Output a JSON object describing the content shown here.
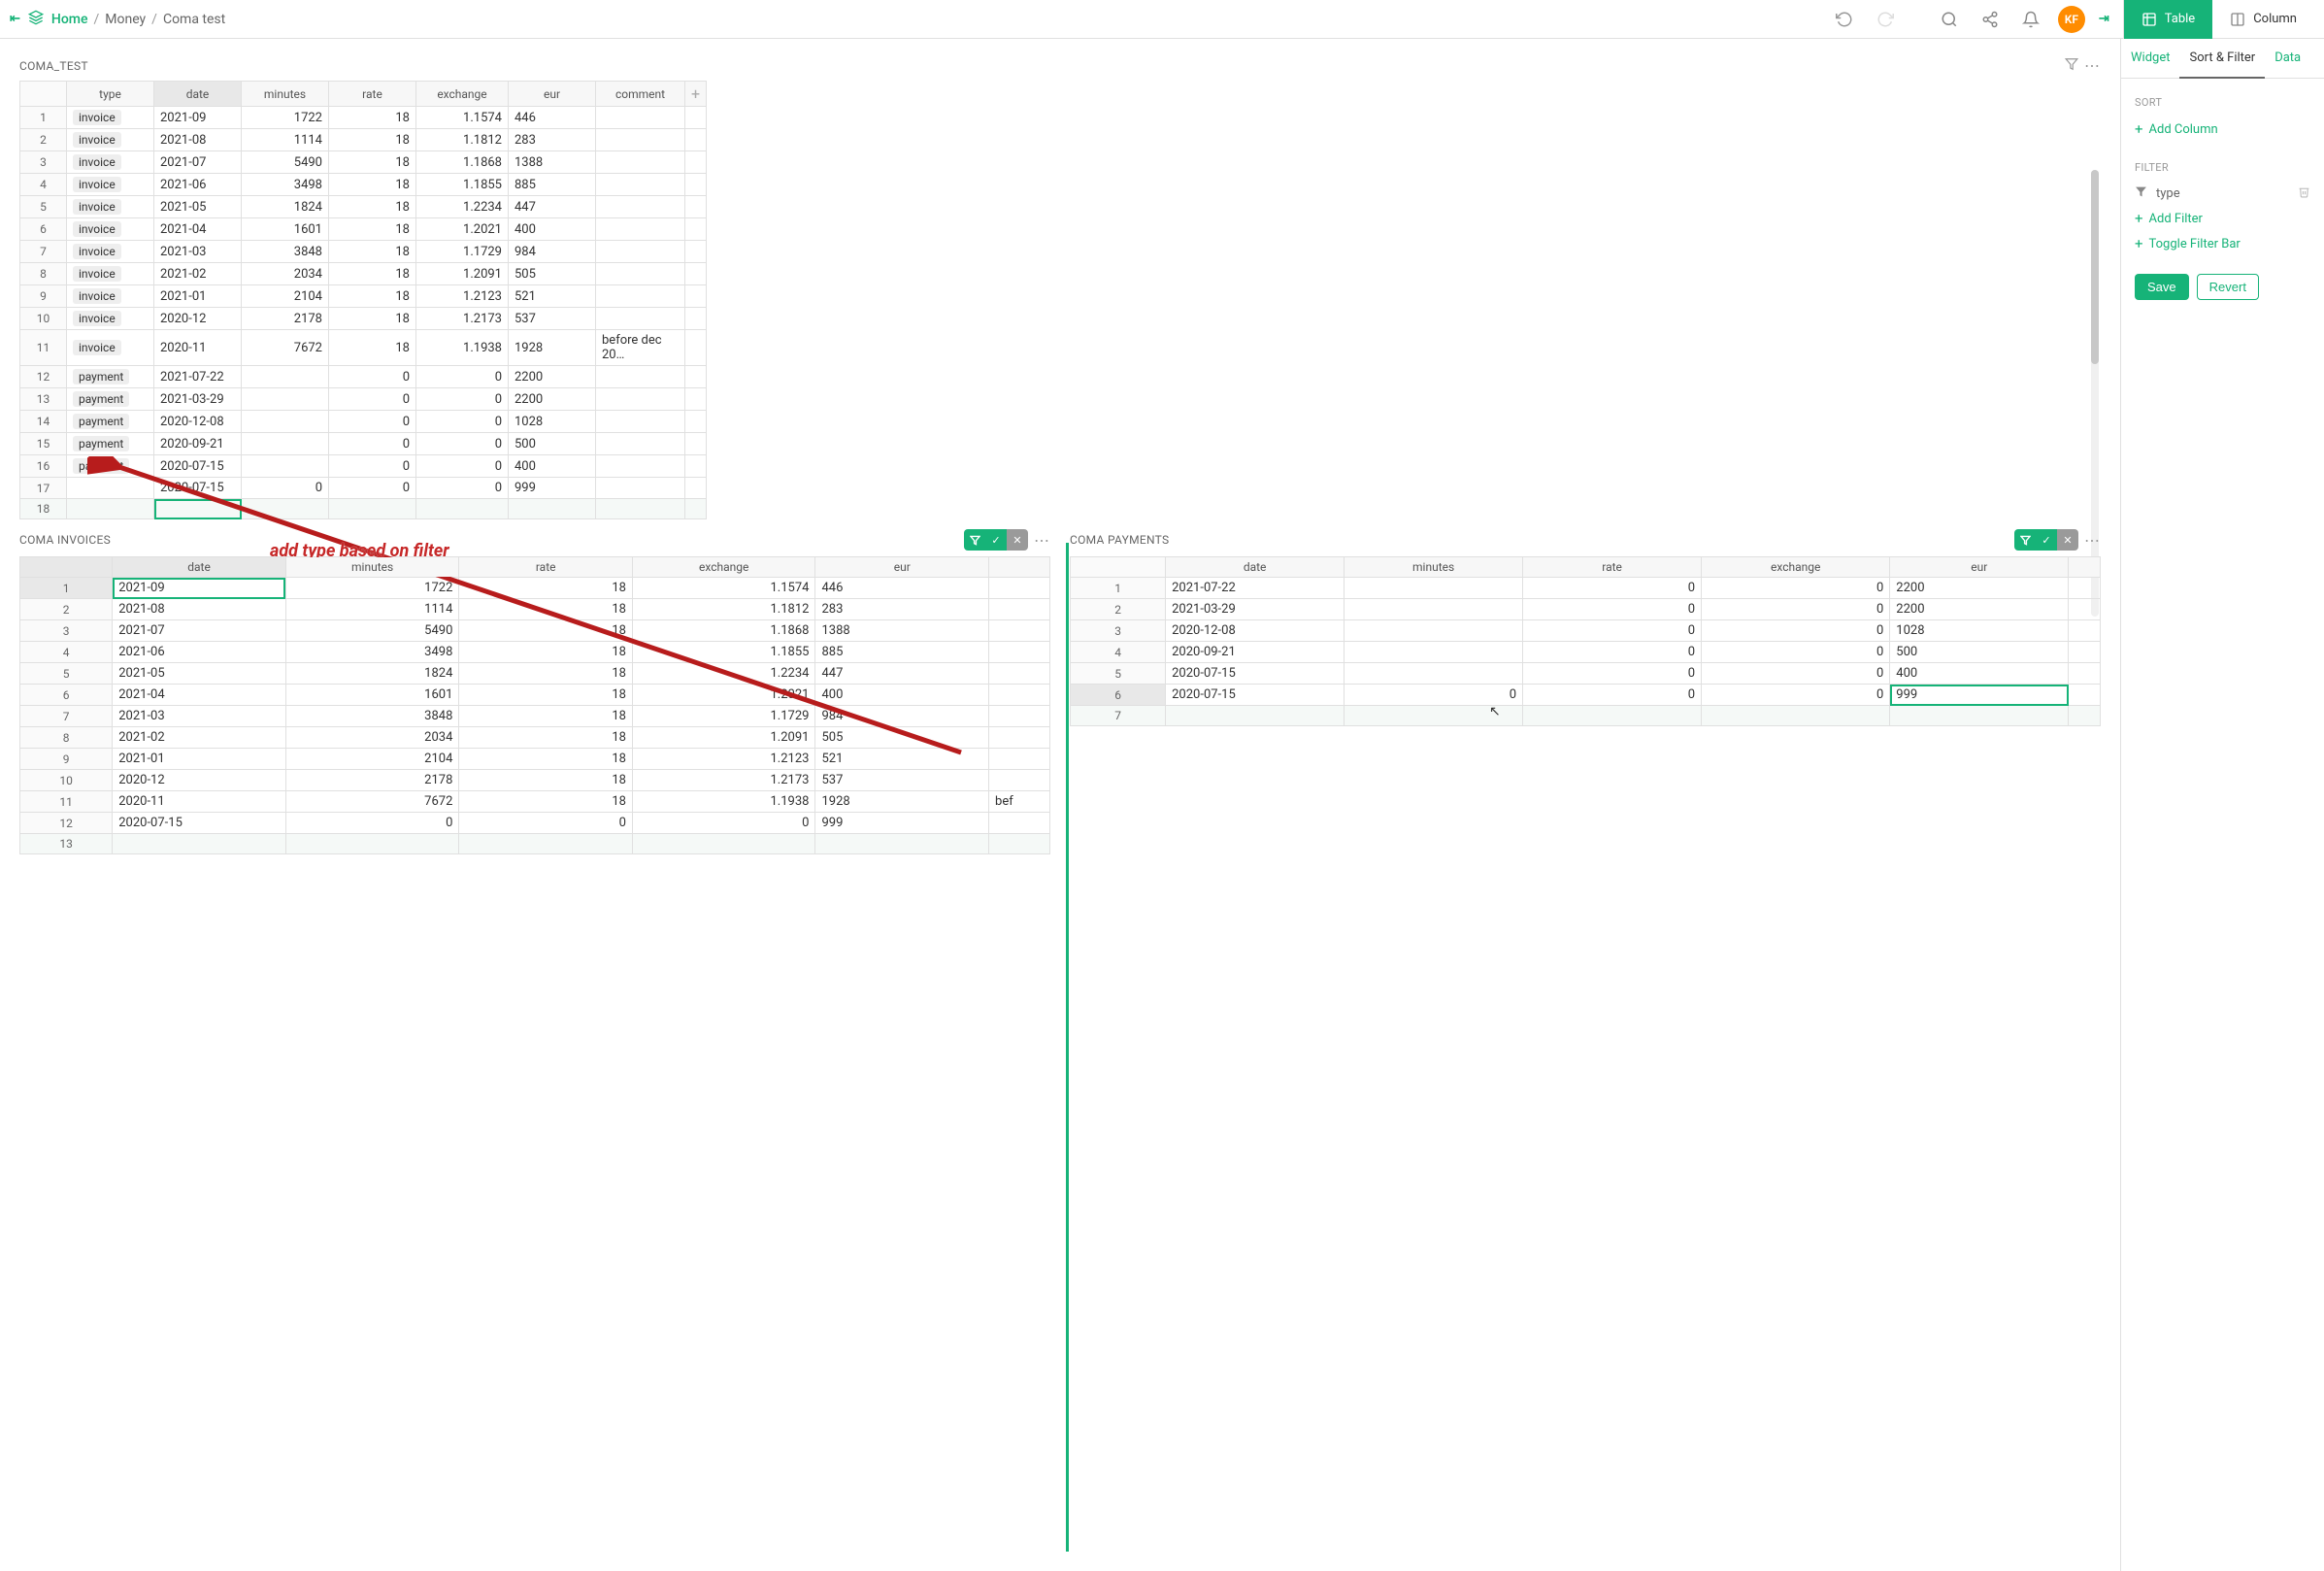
{
  "breadcrumb": {
    "home": "Home",
    "money": "Money",
    "doc": "Coma test"
  },
  "avatar": "KF",
  "view_tabs": {
    "table": "Table",
    "column": "Column"
  },
  "section1": {
    "title": "COMA_TEST",
    "cols": [
      "type",
      "date",
      "minutes",
      "rate",
      "exchange",
      "eur",
      "comment"
    ],
    "rows": [
      {
        "n": "1",
        "type": "invoice",
        "date": "2021-09",
        "min": "1722",
        "rate": "18",
        "exch": "1.1574",
        "eur": "446",
        "comm": ""
      },
      {
        "n": "2",
        "type": "invoice",
        "date": "2021-08",
        "min": "1114",
        "rate": "18",
        "exch": "1.1812",
        "eur": "283",
        "comm": ""
      },
      {
        "n": "3",
        "type": "invoice",
        "date": "2021-07",
        "min": "5490",
        "rate": "18",
        "exch": "1.1868",
        "eur": "1388",
        "comm": ""
      },
      {
        "n": "4",
        "type": "invoice",
        "date": "2021-06",
        "min": "3498",
        "rate": "18",
        "exch": "1.1855",
        "eur": "885",
        "comm": ""
      },
      {
        "n": "5",
        "type": "invoice",
        "date": "2021-05",
        "min": "1824",
        "rate": "18",
        "exch": "1.2234",
        "eur": "447",
        "comm": ""
      },
      {
        "n": "6",
        "type": "invoice",
        "date": "2021-04",
        "min": "1601",
        "rate": "18",
        "exch": "1.2021",
        "eur": "400",
        "comm": ""
      },
      {
        "n": "7",
        "type": "invoice",
        "date": "2021-03",
        "min": "3848",
        "rate": "18",
        "exch": "1.1729",
        "eur": "984",
        "comm": ""
      },
      {
        "n": "8",
        "type": "invoice",
        "date": "2021-02",
        "min": "2034",
        "rate": "18",
        "exch": "1.2091",
        "eur": "505",
        "comm": ""
      },
      {
        "n": "9",
        "type": "invoice",
        "date": "2021-01",
        "min": "2104",
        "rate": "18",
        "exch": "1.2123",
        "eur": "521",
        "comm": ""
      },
      {
        "n": "10",
        "type": "invoice",
        "date": "2020-12",
        "min": "2178",
        "rate": "18",
        "exch": "1.2173",
        "eur": "537",
        "comm": ""
      },
      {
        "n": "11",
        "type": "invoice",
        "date": "2020-11",
        "min": "7672",
        "rate": "18",
        "exch": "1.1938",
        "eur": "1928",
        "comm": "before dec 20…"
      },
      {
        "n": "12",
        "type": "payment",
        "date": "2021-07-22",
        "min": "",
        "rate": "0",
        "exch": "0",
        "eur": "2200",
        "comm": ""
      },
      {
        "n": "13",
        "type": "payment",
        "date": "2021-03-29",
        "min": "",
        "rate": "0",
        "exch": "0",
        "eur": "2200",
        "comm": ""
      },
      {
        "n": "14",
        "type": "payment",
        "date": "2020-12-08",
        "min": "",
        "rate": "0",
        "exch": "0",
        "eur": "1028",
        "comm": ""
      },
      {
        "n": "15",
        "type": "payment",
        "date": "2020-09-21",
        "min": "",
        "rate": "0",
        "exch": "0",
        "eur": "500",
        "comm": ""
      },
      {
        "n": "16",
        "type": "payment",
        "date": "2020-07-15",
        "min": "",
        "rate": "0",
        "exch": "0",
        "eur": "400",
        "comm": ""
      },
      {
        "n": "17",
        "type": "",
        "date": "2020-07-15",
        "min": "0",
        "rate": "0",
        "exch": "0",
        "eur": "999",
        "comm": ""
      }
    ],
    "newrow_n": "18"
  },
  "section2": {
    "title": "COMA INVOICES",
    "cols": [
      "date",
      "minutes",
      "rate",
      "exchange",
      "eur",
      ""
    ],
    "rows": [
      {
        "n": "1",
        "date": "2021-09",
        "min": "1722",
        "rate": "18",
        "exch": "1.1574",
        "eur": "446",
        "c": ""
      },
      {
        "n": "2",
        "date": "2021-08",
        "min": "1114",
        "rate": "18",
        "exch": "1.1812",
        "eur": "283",
        "c": ""
      },
      {
        "n": "3",
        "date": "2021-07",
        "min": "5490",
        "rate": "18",
        "exch": "1.1868",
        "eur": "1388",
        "c": ""
      },
      {
        "n": "4",
        "date": "2021-06",
        "min": "3498",
        "rate": "18",
        "exch": "1.1855",
        "eur": "885",
        "c": ""
      },
      {
        "n": "5",
        "date": "2021-05",
        "min": "1824",
        "rate": "18",
        "exch": "1.2234",
        "eur": "447",
        "c": ""
      },
      {
        "n": "6",
        "date": "2021-04",
        "min": "1601",
        "rate": "18",
        "exch": "1.2021",
        "eur": "400",
        "c": ""
      },
      {
        "n": "7",
        "date": "2021-03",
        "min": "3848",
        "rate": "18",
        "exch": "1.1729",
        "eur": "984",
        "c": ""
      },
      {
        "n": "8",
        "date": "2021-02",
        "min": "2034",
        "rate": "18",
        "exch": "1.2091",
        "eur": "505",
        "c": ""
      },
      {
        "n": "9",
        "date": "2021-01",
        "min": "2104",
        "rate": "18",
        "exch": "1.2123",
        "eur": "521",
        "c": ""
      },
      {
        "n": "10",
        "date": "2020-12",
        "min": "2178",
        "rate": "18",
        "exch": "1.2173",
        "eur": "537",
        "c": ""
      },
      {
        "n": "11",
        "date": "2020-11",
        "min": "7672",
        "rate": "18",
        "exch": "1.1938",
        "eur": "1928",
        "c": "bef"
      },
      {
        "n": "12",
        "date": "2020-07-15",
        "min": "0",
        "rate": "0",
        "exch": "0",
        "eur": "999",
        "c": ""
      }
    ],
    "newrow_n": "13"
  },
  "section3": {
    "title": "COMA PAYMENTS",
    "cols": [
      "date",
      "minutes",
      "rate",
      "exchange",
      "eur",
      ""
    ],
    "rows": [
      {
        "n": "1",
        "date": "2021-07-22",
        "min": "",
        "rate": "0",
        "exch": "0",
        "eur": "2200"
      },
      {
        "n": "2",
        "date": "2021-03-29",
        "min": "",
        "rate": "0",
        "exch": "0",
        "eur": "2200"
      },
      {
        "n": "3",
        "date": "2020-12-08",
        "min": "",
        "rate": "0",
        "exch": "0",
        "eur": "1028"
      },
      {
        "n": "4",
        "date": "2020-09-21",
        "min": "",
        "rate": "0",
        "exch": "0",
        "eur": "500"
      },
      {
        "n": "5",
        "date": "2020-07-15",
        "min": "",
        "rate": "0",
        "exch": "0",
        "eur": "400"
      },
      {
        "n": "6",
        "date": "2020-07-15",
        "min": "0",
        "rate": "0",
        "exch": "0",
        "eur": "999"
      }
    ],
    "newrow_n": "7"
  },
  "panel": {
    "tabs": {
      "widget": "Widget",
      "sort": "Sort & Filter",
      "data": "Data"
    },
    "sort_label": "SORT",
    "add_column": "Add Column",
    "filter_label": "FILTER",
    "filter_col": "type",
    "add_filter": "Add Filter",
    "toggle_filter": "Toggle Filter Bar",
    "save": "Save",
    "revert": "Revert"
  },
  "annotation": "add type based on filter"
}
